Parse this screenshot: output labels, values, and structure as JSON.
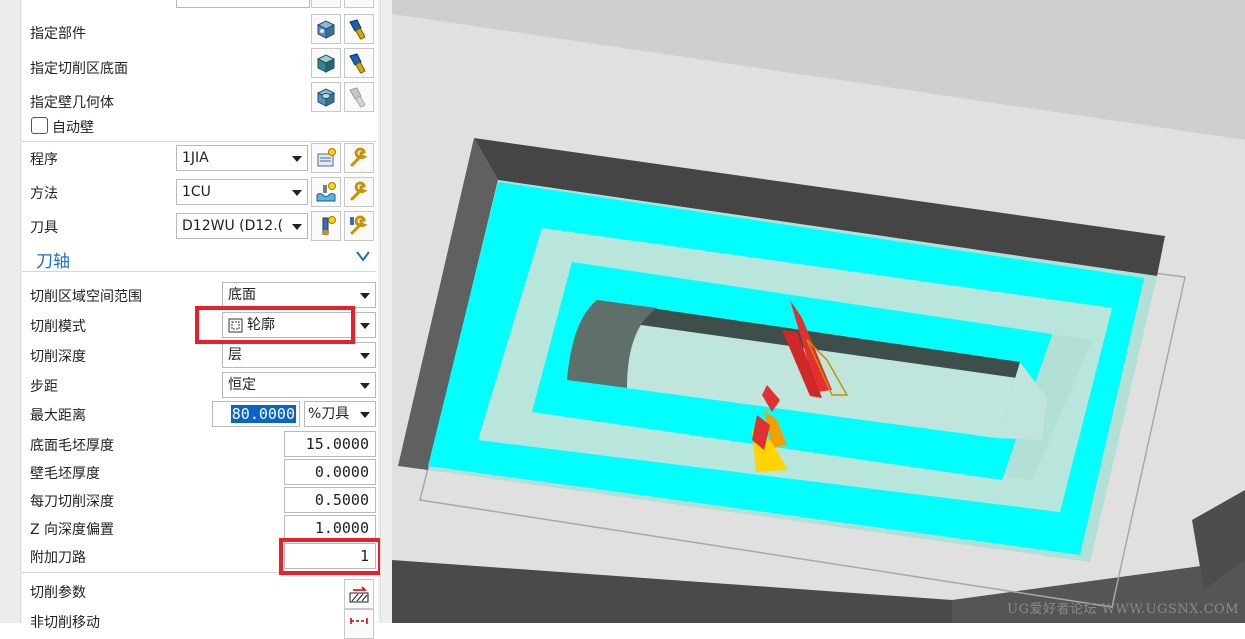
{
  "panel": {
    "specify_part": "指定部件",
    "specify_floor": "指定切削区底面",
    "specify_wall": "指定壁几何体",
    "auto_wall": "自动壁",
    "program_label": "程序",
    "program_value": "1JIA",
    "method_label": "方法",
    "method_value": "1CU",
    "tool_label": "刀具",
    "tool_value": "D12WU (D12.(",
    "axis_section": "刀轴",
    "cut_region_label": "切削区域空间范围",
    "cut_region_value": "底面",
    "cut_mode_label": "切削模式",
    "cut_mode_value": "轮廓",
    "cut_depth_label": "切削深度",
    "cut_depth_value": "层",
    "stepover_label": "步距",
    "stepover_value": "恒定",
    "max_distance_label": "最大距离",
    "max_distance_value": "80.0000",
    "max_distance_unit": "%刀具",
    "floor_stock_label": "底面毛坯厚度",
    "floor_stock_value": "15.0000",
    "wall_stock_label": "壁毛坯厚度",
    "wall_stock_value": "0.0000",
    "depth_per_cut_label": "每刀切削深度",
    "depth_per_cut_value": "0.5000",
    "z_offset_label": "Z 向深度偏置",
    "z_offset_value": "1.0000",
    "additional_passes_label": "附加刀路",
    "additional_passes_value": "1",
    "cutting_params_label": "切削参数",
    "non_cutting_label": "非切削移动"
  },
  "viewport": {
    "watermark": "UG爱好者论坛 WWW.UGSNX.COM"
  },
  "colors": {
    "accent_blue": "#1e6fbe",
    "highlight_red": "#e8202a",
    "toolpath_cyan": "#00ffff",
    "floor_mint": "#b2dfd6"
  }
}
